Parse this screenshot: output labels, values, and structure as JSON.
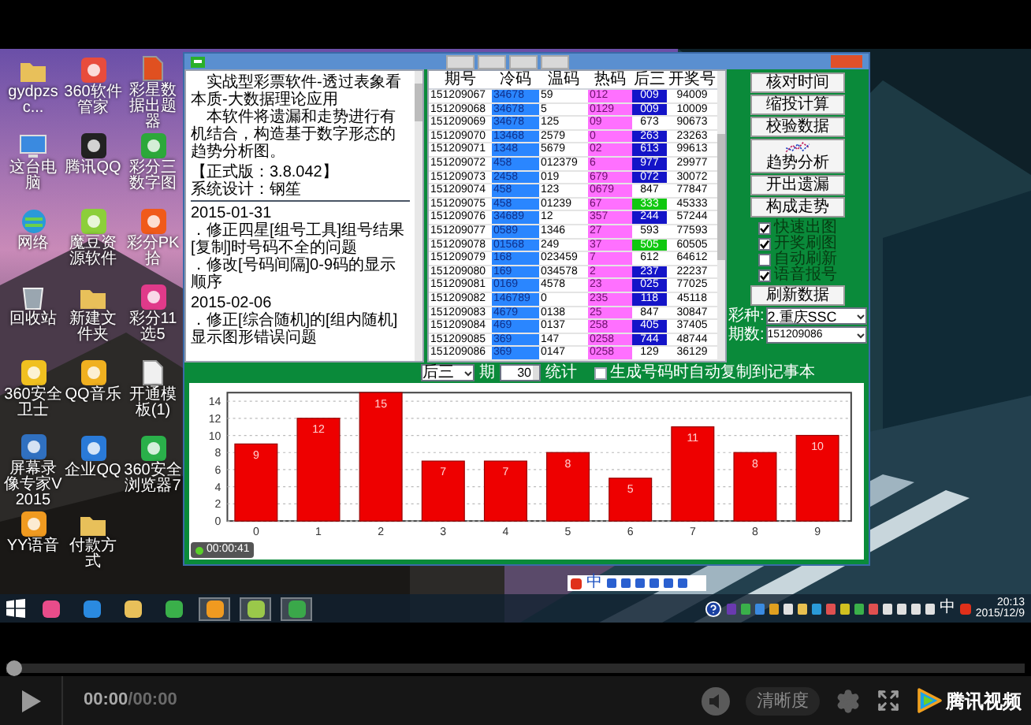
{
  "video_frame": {
    "desktop_icons": [
      {
        "label": "gydpzsc..."
      },
      {
        "label": "360软件管家"
      },
      {
        "label": "彩星数据出题器"
      },
      {
        "label": "这台电脑"
      },
      {
        "label": "腾讯QQ"
      },
      {
        "label": "彩分三数字图"
      },
      {
        "label": "网络"
      },
      {
        "label": "魔豆资源软件"
      },
      {
        "label": "彩分PK拾"
      },
      {
        "label": "回收站"
      },
      {
        "label": "新建文件夹"
      },
      {
        "label": "彩分11选5"
      },
      {
        "label": "360安全卫士"
      },
      {
        "label": "QQ音乐"
      },
      {
        "label": "开通模板(1)"
      },
      {
        "label": "屏幕录像专家V2015"
      },
      {
        "label": "企业QQ"
      },
      {
        "label": "360安全浏览器7"
      },
      {
        "label": "YY语音"
      },
      {
        "label": "付款方式"
      }
    ],
    "app_window": {
      "notes": {
        "paragraphs": [
          "实战型彩票软件-透过表象看本质-大数据理论应用",
          "本软件将遗漏和走势进行有机结合，构造基于数字形态的趋势分析图。"
        ],
        "version": "【正式版：3.8.042】",
        "designer": "系统设计：钢笙",
        "changelog": [
          {
            "date": "2015-01-31",
            "items": [
              "．修正四星[组号工具]组号结果[复制]时号码不全的问题",
              "．修改[号码间隔]0-9码的显示顺序"
            ]
          },
          {
            "date": "2015-02-06",
            "items": [
              "．修正[综合随机]的[组内随机]显示图形错误问题"
            ]
          }
        ]
      },
      "table": {
        "columns": [
          "期号",
          "冷码",
          "温码",
          "热码",
          "后三",
          "开奖号"
        ],
        "rows": [
          {
            "period": "151209067",
            "cold": "34678",
            "warm": "59",
            "hot": "012",
            "hou_san": {
              "value": "009",
              "color": "#1414c8"
            },
            "draw": "94009"
          },
          {
            "period": "151209068",
            "cold": "34678",
            "warm": "5",
            "hot": "0129",
            "hou_san": {
              "value": "009",
              "color": "#1414c8"
            },
            "draw": "10009"
          },
          {
            "period": "151209069",
            "cold": "34678",
            "warm": "125",
            "hot": "09",
            "hou_san": {
              "value": "673"
            },
            "draw": "90673"
          },
          {
            "period": "151209070",
            "cold": "13468",
            "warm": "2579",
            "hot": "0",
            "hou_san": {
              "value": "263",
              "color": "#1414c8"
            },
            "draw": "23263"
          },
          {
            "period": "151209071",
            "cold": "1348",
            "warm": "5679",
            "hot": "02",
            "hou_san": {
              "value": "613",
              "color": "#1414c8"
            },
            "draw": "99613"
          },
          {
            "period": "151209072",
            "cold": "458",
            "warm": "012379",
            "hot": "6",
            "hou_san": {
              "value": "977",
              "color": "#1414c8"
            },
            "draw": "29977"
          },
          {
            "period": "151209073",
            "cold": "2458",
            "warm": "019",
            "hot": "679",
            "hou_san": {
              "value": "072",
              "color": "#1414c8"
            },
            "draw": "30072"
          },
          {
            "period": "151209074",
            "cold": "458",
            "warm": "123",
            "hot": "0679",
            "hou_san": {
              "value": "847"
            },
            "draw": "77847"
          },
          {
            "period": "151209075",
            "cold": "458",
            "warm": "01239",
            "hot": "67",
            "hou_san": {
              "value": "333",
              "color": "#10c810"
            },
            "draw": "45333"
          },
          {
            "period": "151209076",
            "cold": "34689",
            "warm": "12",
            "hot": "357",
            "hou_san": {
              "value": "244",
              "color": "#1414c8"
            },
            "draw": "57244"
          },
          {
            "period": "151209077",
            "cold": "0589",
            "warm": "1346",
            "hot": "27",
            "hou_san": {
              "value": "593"
            },
            "draw": "77593"
          },
          {
            "period": "151209078",
            "cold": "01568",
            "warm": "249",
            "hot": "37",
            "hou_san": {
              "value": "505",
              "color": "#10c810"
            },
            "draw": "60505"
          },
          {
            "period": "151209079",
            "cold": "168",
            "warm": "023459",
            "hot": "7",
            "hou_san": {
              "value": "612"
            },
            "draw": "64612"
          },
          {
            "period": "151209080",
            "cold": "169",
            "warm": "034578",
            "hot": "2",
            "hou_san": {
              "value": "237",
              "color": "#1414c8"
            },
            "draw": "22237"
          },
          {
            "period": "151209081",
            "cold": "0169",
            "warm": "4578",
            "hot": "23",
            "hou_san": {
              "value": "025",
              "color": "#1414c8"
            },
            "draw": "77025"
          },
          {
            "period": "151209082",
            "cold": "146789",
            "warm": "0",
            "hot": "235",
            "hou_san": {
              "value": "118",
              "color": "#1414c8"
            },
            "draw": "45118"
          },
          {
            "period": "151209083",
            "cold": "4679",
            "warm": "0138",
            "hot": "25",
            "hou_san": {
              "value": "847"
            },
            "draw": "30847"
          },
          {
            "period": "151209084",
            "cold": "469",
            "warm": "0137",
            "hot": "258",
            "hou_san": {
              "value": "405",
              "color": "#1414c8"
            },
            "draw": "37405"
          },
          {
            "period": "151209085",
            "cold": "369",
            "warm": "147",
            "hot": "0258",
            "hou_san": {
              "value": "744",
              "color": "#1414c8"
            },
            "draw": "48744"
          },
          {
            "period": "151209086",
            "cold": "369",
            "warm": "0147",
            "hot": "0258",
            "hou_san": {
              "value": "129"
            },
            "draw": "36129"
          }
        ]
      },
      "side_panel": {
        "buttons": [
          "核对时间",
          "缩投计算",
          "校验数据"
        ],
        "trend_button": "趋势分析",
        "buttons_2": [
          "开出遗漏",
          "构成走势"
        ],
        "checkboxes": [
          {
            "label": "快速出图",
            "checked": true
          },
          {
            "label": "开奖刷图",
            "checked": true
          },
          {
            "label": "自动刷新",
            "checked": false
          },
          {
            "label": "语音报号",
            "checked": true
          }
        ],
        "refresh_button": "刷新数据",
        "lottery": {
          "label": "彩种:",
          "value": "2.重庆SSC"
        },
        "period": {
          "label": "期数:",
          "value": "151209086"
        }
      },
      "chart_toolbar": {
        "position_select": "后三",
        "periods_label": "期",
        "periods_value": "30",
        "stat_button": "统计",
        "auto_copy": {
          "label": "生成号码时自动复制到记事本",
          "checked": false
        }
      },
      "chart_data": {
        "type": "bar",
        "categories": [
          "0",
          "1",
          "2",
          "3",
          "4",
          "5",
          "6",
          "7",
          "8",
          "9"
        ],
        "values": [
          9,
          12,
          15,
          7,
          7,
          8,
          5,
          11,
          8,
          10
        ],
        "ylim": [
          0,
          15
        ],
        "yticks": [
          0,
          2,
          4,
          6,
          8,
          10,
          12,
          14
        ],
        "grid": true,
        "data_labels": true
      },
      "recording_timer": "00:00:41"
    },
    "taskbar": {
      "ime_label": "中",
      "tray_language": "中",
      "time": "20:13",
      "date": "2015/12/9"
    }
  },
  "player": {
    "progress": {
      "level": 0
    },
    "current_time": "00:00",
    "duration": "/00:00",
    "quality_button": "清晰度",
    "brand": "腾讯视频"
  }
}
